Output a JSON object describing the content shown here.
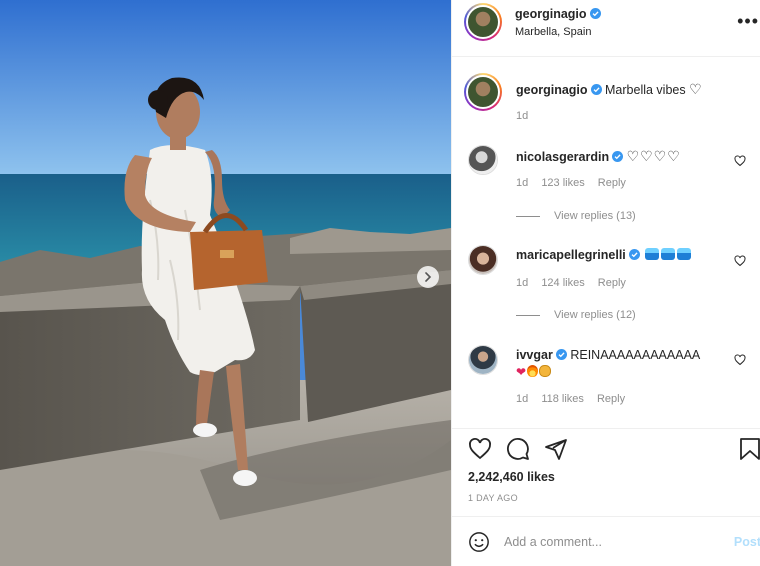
{
  "post": {
    "author": "georginagio",
    "location": "Marbella, Spain",
    "caption_text": "Marbella vibes",
    "caption_emoji": "♡",
    "caption_age": "1d"
  },
  "comments": [
    {
      "username": "nicolasgerardin",
      "text": "♡♡♡♡",
      "age": "1d",
      "likes": "123 likes",
      "reply": "Reply",
      "view_replies": "View replies (13)"
    },
    {
      "username": "maricapellegrinelli",
      "text": "",
      "age": "1d",
      "likes": "124 likes",
      "reply": "Reply",
      "view_replies": "View replies (12)"
    },
    {
      "username": "ivvgar",
      "text": "REINAAAAAAAAAAAA",
      "emoji_line": "❤",
      "age": "1d",
      "likes": "118 likes",
      "reply": "Reply"
    }
  ],
  "stats": {
    "likes": "2,242,460 likes",
    "posted": "1 DAY AGO"
  },
  "add_comment": {
    "placeholder": "Add a comment...",
    "post_label": "Post"
  },
  "icons": [
    "verified-badge-icon",
    "more-options-icon",
    "heart-icon",
    "comment-icon",
    "share-icon",
    "bookmark-icon",
    "emoji-icon",
    "chevron-right-icon"
  ],
  "colors": {
    "accent": "#0095f6",
    "post_button_disabled": "#b2dffc",
    "muted_text": "#8e8e8e",
    "border": "#efefef"
  }
}
